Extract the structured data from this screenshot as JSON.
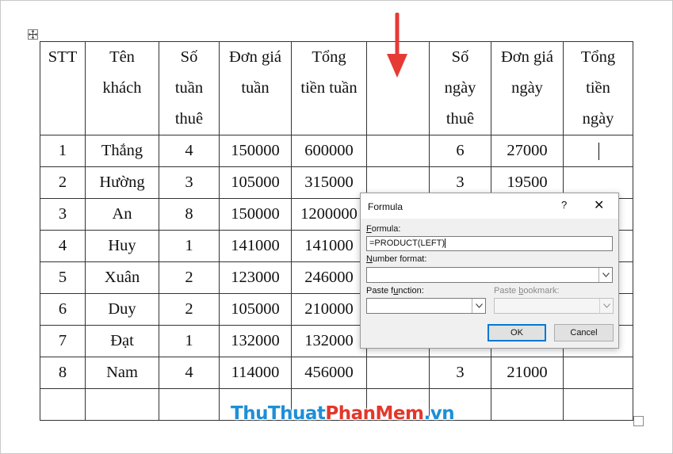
{
  "table": {
    "headers": [
      [
        "STT"
      ],
      [
        "Tên",
        "khách"
      ],
      [
        "Số",
        "tuần",
        "thuê"
      ],
      [
        "Đơn giá",
        "tuần"
      ],
      [
        "Tổng",
        "tiền tuần"
      ],
      [
        ""
      ],
      [
        "Số",
        "ngày",
        "thuê"
      ],
      [
        "Đơn giá",
        "ngày"
      ],
      [
        "Tổng",
        "tiền",
        "ngày"
      ]
    ],
    "rows": [
      [
        "1",
        "Thắng",
        "4",
        "150000",
        "600000",
        "",
        "6",
        "27000",
        ""
      ],
      [
        "2",
        "Hường",
        "3",
        "105000",
        "315000",
        "",
        "3",
        "19500",
        ""
      ],
      [
        "3",
        "An",
        "8",
        "150000",
        "1200000",
        "",
        "",
        "",
        ""
      ],
      [
        "4",
        "Huy",
        "1",
        "141000",
        "141000",
        "",
        "",
        "",
        ""
      ],
      [
        "5",
        "Xuân",
        "2",
        "123000",
        "246000",
        "",
        "",
        "",
        ""
      ],
      [
        "6",
        "Duy",
        "2",
        "105000",
        "210000",
        "",
        "",
        "",
        ""
      ],
      [
        "7",
        "Đạt",
        "1",
        "132000",
        "132000",
        "",
        "",
        "",
        ""
      ],
      [
        "8",
        "Nam",
        "4",
        "114000",
        "456000",
        "",
        "3",
        "21000",
        ""
      ],
      [
        "",
        "",
        "",
        "",
        "",
        "",
        "",
        "",
        ""
      ]
    ]
  },
  "dialog": {
    "title": "Formula",
    "help": "?",
    "close": "✕",
    "formula_label_pre": "",
    "formula_label_u": "F",
    "formula_label_post": "ormula:",
    "formula_value": "=PRODUCT(LEFT)",
    "number_format_label_pre": "",
    "number_format_label_u": "N",
    "number_format_label_post": "umber format:",
    "number_format_value": "",
    "paste_function_label_pre": "Paste f",
    "paste_function_label_u": "u",
    "paste_function_label_post": "nction:",
    "paste_bookmark_label_pre": "Paste ",
    "paste_bookmark_label_u": "b",
    "paste_bookmark_label_post": "ookmark:",
    "ok_label": "OK",
    "cancel_label": "Cancel"
  },
  "watermark": {
    "part1": "ThuThuat",
    "part2": "PhanMem",
    "part3": ".vn"
  },
  "colors": {
    "arrow": "#e63a35",
    "accent": "#0078d7"
  }
}
